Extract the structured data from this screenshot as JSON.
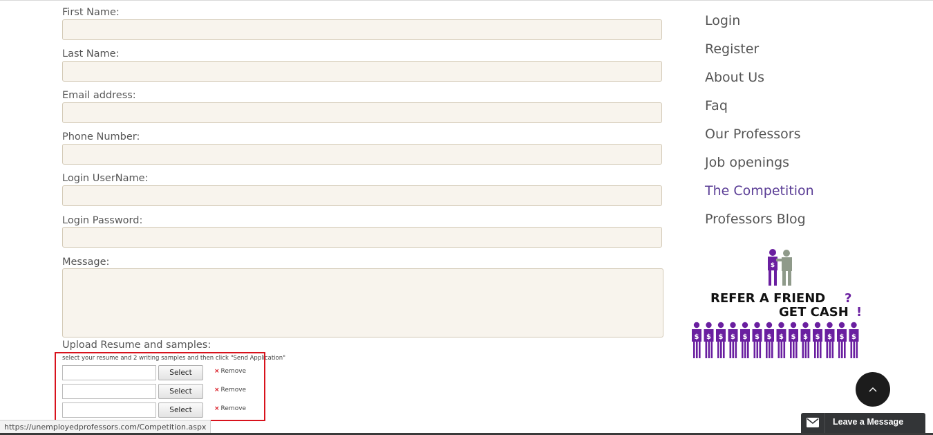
{
  "form": {
    "fields": [
      {
        "label": "First Name:",
        "value": ""
      },
      {
        "label": "Last Name:",
        "value": ""
      },
      {
        "label": "Email address:",
        "value": ""
      },
      {
        "label": "Phone Number:",
        "value": ""
      },
      {
        "label": "Login UserName:",
        "value": ""
      },
      {
        "label": "Login Password:",
        "value": ""
      }
    ],
    "message": {
      "label": "Message:",
      "value": ""
    },
    "upload": {
      "label": "Upload Resume and samples:",
      "hint": "select your resume and 2 writing samples and then click \"Send Application\"",
      "rows": [
        {
          "select_label": "Select",
          "remove_label": "Remove"
        },
        {
          "select_label": "Select",
          "remove_label": "Remove"
        },
        {
          "select_label": "Select",
          "remove_label": "Remove"
        }
      ]
    }
  },
  "sidebar": {
    "nav": [
      {
        "label": "Login"
      },
      {
        "label": "Register"
      },
      {
        "label": "About Us"
      },
      {
        "label": "Faq"
      },
      {
        "label": "Our Professors"
      },
      {
        "label": "Job openings"
      },
      {
        "label": "The Competition",
        "active": true
      },
      {
        "label": "Professors Blog"
      }
    ],
    "promo": {
      "line1": "REFER A FRIEND",
      "mark1": "?",
      "line2": "GET CASH",
      "mark2": "!",
      "symbol": "$"
    }
  },
  "status_bar": {
    "url": "https://unemployedprofessors.com/Competition.aspx"
  },
  "chat": {
    "label": "Leave a Message",
    "icon": "envelope-icon"
  },
  "scroll_top": {
    "icon": "chevron-up-icon"
  },
  "colors": {
    "accent": "#5b3e96",
    "input_bg": "#f8f4ed",
    "highlight": "#d8121c",
    "promo_purple": "#6a1fa0"
  }
}
